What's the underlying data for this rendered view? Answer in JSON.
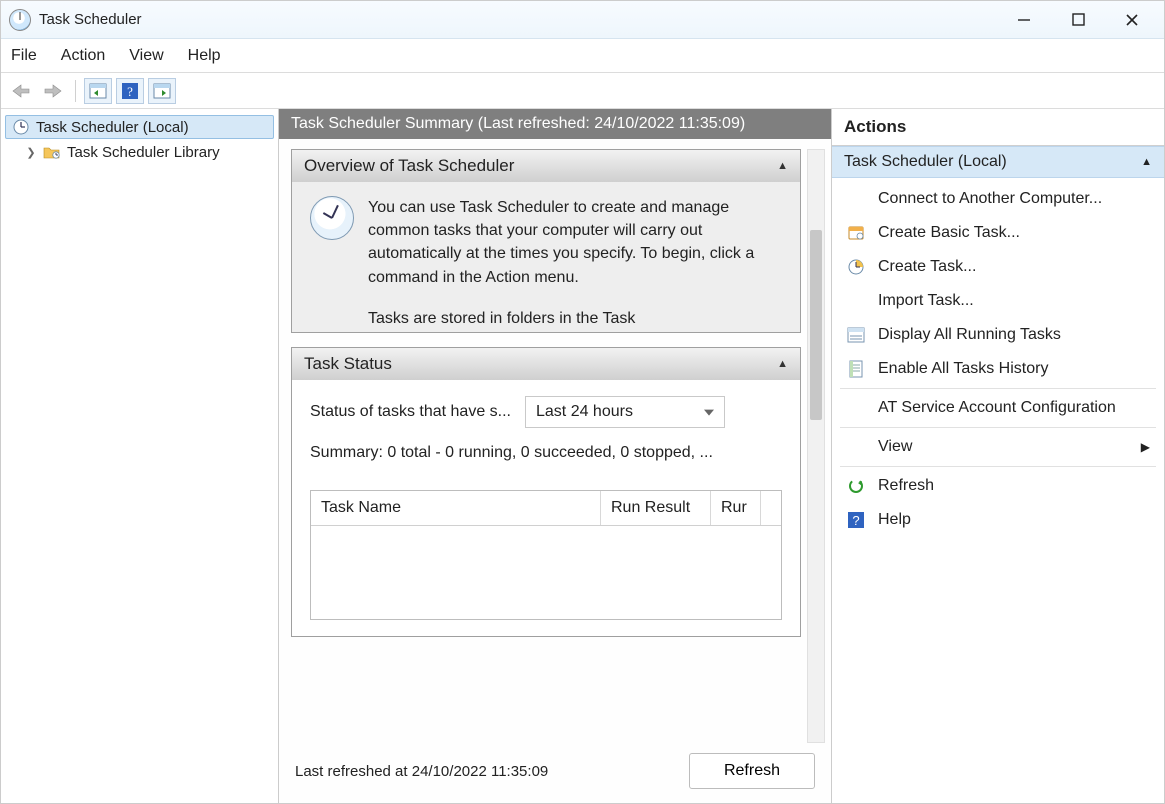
{
  "titlebar": {
    "title": "Task Scheduler"
  },
  "menu": {
    "file": "File",
    "action": "Action",
    "view": "View",
    "help": "Help"
  },
  "tree": {
    "root": "Task Scheduler (Local)",
    "library": "Task Scheduler Library"
  },
  "center": {
    "header": "Task Scheduler Summary (Last refreshed: 24/10/2022 11:35:09)",
    "overview": {
      "title": "Overview of Task Scheduler",
      "text": "You can use Task Scheduler to create and manage common tasks that your computer will carry out automatically at the times you specify. To begin, click a command in the Action menu.",
      "text_cut": "Tasks are stored in folders in the Task"
    },
    "taskstatus": {
      "title": "Task Status",
      "label": "Status of tasks that have s...",
      "timeframe": "Last 24 hours",
      "summary": "Summary: 0 total - 0 running, 0 succeeded, 0 stopped, ...",
      "columns": {
        "name": "Task Name",
        "result": "Run Result",
        "run": "Rur"
      }
    },
    "footer": {
      "last_refreshed": "Last refreshed at 24/10/2022 11:35:09",
      "refresh": "Refresh"
    }
  },
  "actions": {
    "title": "Actions",
    "scope": "Task Scheduler (Local)",
    "items": {
      "connect": "Connect to Another Computer...",
      "create_basic": "Create Basic Task...",
      "create_task": "Create Task...",
      "import": "Import Task...",
      "display_running": "Display All Running Tasks",
      "enable_history": "Enable All Tasks History",
      "at_service": "AT Service Account Configuration",
      "view": "View",
      "refresh": "Refresh",
      "help": "Help"
    }
  }
}
